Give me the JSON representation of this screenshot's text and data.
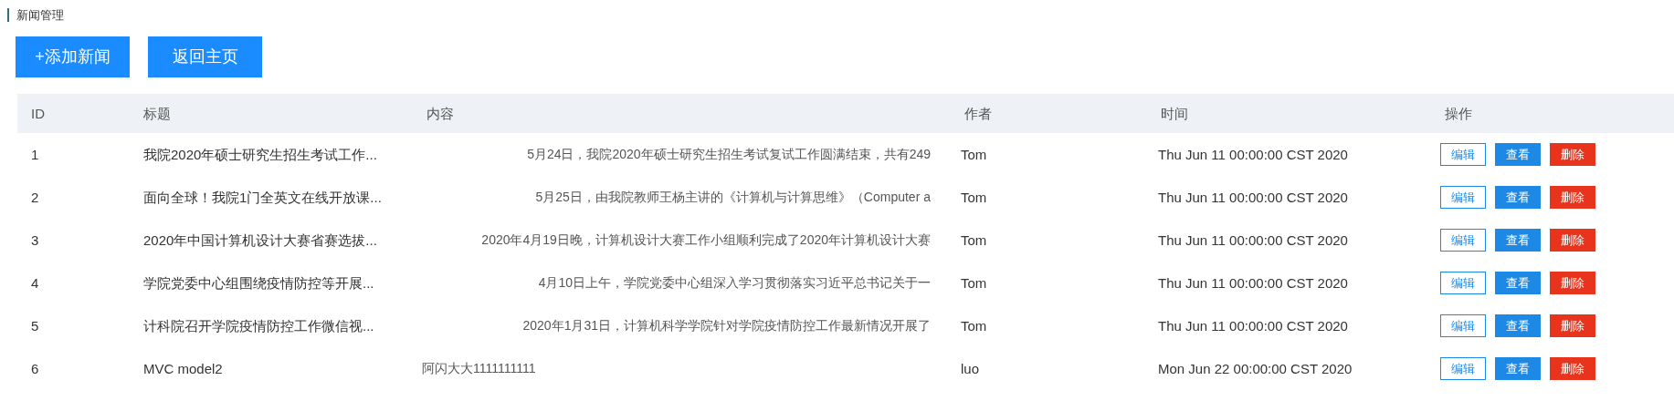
{
  "page_title": "新闻管理",
  "buttons": [
    "+添加新闻",
    "返回主页"
  ],
  "table": {
    "columns": [
      "ID",
      "标题",
      "内容",
      "作者",
      "时间",
      "操作"
    ],
    "rows": [
      {
        "id": "1",
        "title": "我院2020年硕士研究生招生考试工作...",
        "content": "5月24日，我院2020年硕士研究生招生考试复试工作圆满结束，共有249",
        "author": "Tom",
        "time": "Thu Jun 11 00:00:00 CST 2020",
        "actions": [
          "编辑",
          "查看",
          "删除"
        ]
      },
      {
        "id": "2",
        "title": "面向全球！我院1门全英文在线开放课...",
        "content": "5月25日，由我院教师王杨主讲的《计算机与计算思维》（Computer a",
        "author": "Tom",
        "time": "Thu Jun 11 00:00:00 CST 2020",
        "actions": [
          "编辑",
          "查看",
          "删除"
        ]
      },
      {
        "id": "3",
        "title": "2020年中国计算机设计大赛省赛选拔...",
        "content": "2020年4月19日晚，计算机设计大赛工作小组顺利完成了2020年计算机设计大赛",
        "author": "Tom",
        "time": "Thu Jun 11 00:00:00 CST 2020",
        "actions": [
          "编辑",
          "查看",
          "删除"
        ]
      },
      {
        "id": "4",
        "title": "学院党委中心组围绕疫情防控等开展...",
        "content": "4月10日上午，学院党委中心组深入学习贯彻落实习近平总书记关于一",
        "author": "Tom",
        "time": "Thu Jun 11 00:00:00 CST 2020",
        "actions": [
          "编辑",
          "查看",
          "删除"
        ]
      },
      {
        "id": "5",
        "title": "计科院召开学院疫情防控工作微信视...",
        "content": "2020年1月31日，计算机科学学院针对学院疫情防控工作最新情况开展了",
        "author": "Tom",
        "time": "Thu Jun 11 00:00:00 CST 2020",
        "actions": [
          "编辑",
          "查看",
          "删除"
        ]
      },
      {
        "id": "6",
        "title": "MVC model2",
        "content": "阿闪大大1111111111",
        "author": "luo",
        "time": "Mon Jun 22 00:00:00 CST 2020",
        "actions": [
          "编辑",
          "查看",
          "删除"
        ]
      }
    ]
  }
}
